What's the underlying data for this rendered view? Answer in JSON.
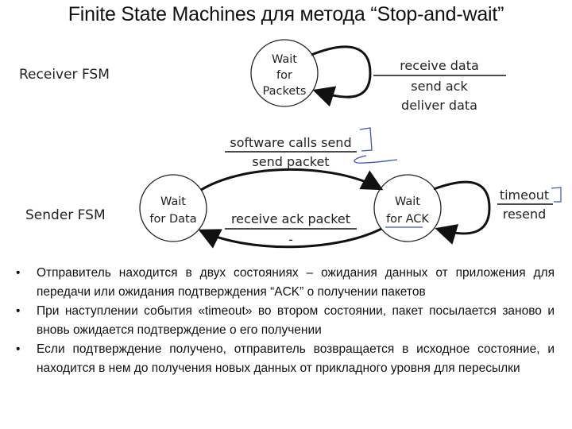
{
  "title": "Finite State Machines для метода “Stop-and-wait”",
  "receiver": {
    "label": "Receiver FSM",
    "state": {
      "lines": [
        "Wait",
        "for",
        "Packets"
      ]
    },
    "self_loop": {
      "event": "receive data",
      "actions": [
        "send ack",
        "deliver data"
      ]
    }
  },
  "sender": {
    "label": "Sender FSM",
    "states": [
      {
        "id": "wait-for-data",
        "lines": [
          "Wait",
          "for Data"
        ]
      },
      {
        "id": "wait-for-ack",
        "lines": [
          "Wait",
          "for ACK"
        ]
      }
    ],
    "transitions": [
      {
        "from": "wait-for-data",
        "to": "wait-for-ack",
        "event": "software calls send",
        "action": "send packet"
      },
      {
        "from": "wait-for-ack",
        "to": "wait-for-data",
        "event": "receive ack packet",
        "action": "-"
      },
      {
        "from": "wait-for-ack",
        "to": "wait-for-ack",
        "event": "timeout",
        "action": "resend"
      }
    ]
  },
  "annotations": {
    "color": "#3a57b5"
  },
  "bullets": [
    {
      "symbol": "•",
      "text": "Отправитель находится в двух состояниях – ожидания данных от приложения для передачи или ожидания подтверждения “ACK” о получении пакетов"
    },
    {
      "symbol": "•",
      "text": "При наступлении события «timeout» во втором состоянии, пакет посылается заново и вновь ожидается подтверждение о его получении"
    },
    {
      "symbol": "•",
      "text": "Если подтверждение получено, отправитель возвращается в исходное состояние, и находится в нем до получения новых данных от прикладного уровня для пересылки"
    }
  ]
}
